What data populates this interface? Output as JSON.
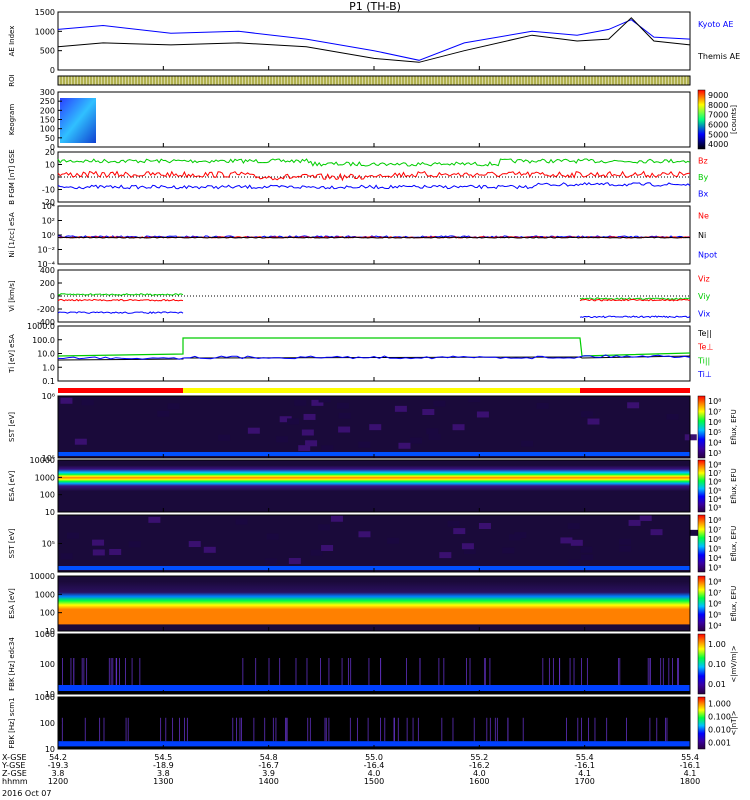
{
  "title": "P1 (TH-B)",
  "colors": {
    "blue": "#0000ff",
    "black": "#000000",
    "green": "#00cc00",
    "red": "#ff0000",
    "yellow": "#ffff00",
    "olive": "#8a8a00",
    "dark_purple": "#1a0a3a"
  },
  "chart_data": [
    {
      "type": "line",
      "id": "ae",
      "ylabel": "AE Index",
      "ylim": [
        0,
        1500
      ],
      "yticks": [
        "1500",
        "1000",
        "500",
        "0"
      ],
      "legend": [
        "Kyoto AE",
        "Themis AE"
      ],
      "series": [
        {
          "name": "Kyoto AE",
          "color": "#0000ff",
          "x": [
            54.2,
            54.3,
            54.45,
            54.6,
            54.75,
            54.9,
            55.0,
            55.1,
            55.25,
            55.35,
            55.42,
            55.47,
            55.52,
            55.6
          ],
          "values": [
            1050,
            1150,
            950,
            1000,
            800,
            500,
            250,
            700,
            1000,
            900,
            1050,
            1300,
            850,
            800
          ]
        },
        {
          "name": "Themis AE",
          "color": "#000000",
          "x": [
            54.2,
            54.3,
            54.45,
            54.6,
            54.75,
            54.9,
            55.0,
            55.1,
            55.25,
            55.35,
            55.42,
            55.47,
            55.52,
            55.6
          ],
          "values": [
            600,
            700,
            650,
            700,
            600,
            300,
            200,
            500,
            900,
            750,
            800,
            1350,
            750,
            650
          ]
        }
      ]
    },
    {
      "type": "table",
      "id": "roi",
      "ylabel": "ROI"
    },
    {
      "type": "heatmap",
      "id": "keogram",
      "ylabel": "Keogram",
      "yticks": [
        "300",
        "250",
        "200",
        "150",
        "100",
        "50",
        "0"
      ],
      "colorbar": {
        "ticks": [
          "9000",
          "8000",
          "7000",
          "6000",
          "5000",
          "4000"
        ],
        "label": "[counts]"
      }
    },
    {
      "type": "line",
      "id": "bfgm",
      "ylabel": "B FGM [nT] GSE",
      "yticks": [
        "20",
        "10",
        "0",
        "-10",
        "-20"
      ],
      "ylim": [
        -20,
        20
      ],
      "legend": [
        "Bz",
        "By",
        "Bx"
      ],
      "series": [
        {
          "name": "Bz",
          "color": "#ff0000"
        },
        {
          "name": "By",
          "color": "#00cc00"
        },
        {
          "name": "Bx",
          "color": "#0000ff"
        }
      ]
    },
    {
      "type": "line",
      "id": "ni",
      "ylabel": "Ni [1/cc] eSA",
      "yticks": [
        "10⁴",
        "10²",
        "10⁰",
        "10⁻²",
        "10⁻⁴"
      ],
      "legend": [
        "Ne",
        "Ni",
        "Npot"
      ]
    },
    {
      "type": "line",
      "id": "vi",
      "ylabel": "Vi [km/s]",
      "yticks": [
        "400",
        "200",
        "0",
        "-200",
        "-400"
      ],
      "ylim": [
        -500,
        500
      ],
      "legend": [
        "Viz",
        "Viy",
        "Vix"
      ]
    },
    {
      "type": "line",
      "id": "ti",
      "ylabel": "Ti [eV] eSA",
      "yticks": [
        "1000.0",
        "100.0",
        "10.0",
        "1.0",
        "0.1"
      ],
      "legend": [
        "Te||",
        "Te⊥",
        "Ti||",
        "Ti⊥"
      ]
    },
    {
      "type": "table",
      "id": "mode"
    },
    {
      "type": "heatmap",
      "id": "sst1",
      "ylabel": "SST [eV]",
      "yticks": [
        "10⁶",
        "10⁵"
      ],
      "colorbar": {
        "ticks": [
          "10⁸",
          "10⁷",
          "10⁶",
          "10⁵",
          "10⁴",
          "10³"
        ],
        "label": "Eflux, EFU"
      }
    },
    {
      "type": "heatmap",
      "id": "esa1",
      "ylabel": "ESA [eV]",
      "yticks": [
        "10000",
        "1000",
        "100",
        "10"
      ],
      "colorbar": {
        "ticks": [
          "10⁸",
          "10⁷",
          "10⁶",
          "10⁵",
          "10⁴",
          "10³"
        ],
        "label": "Eflux, EFU"
      }
    },
    {
      "type": "heatmap",
      "id": "sst2",
      "ylabel": "SST [eV]",
      "yticks": [
        "10⁵"
      ],
      "colorbar": {
        "ticks": [
          "10⁸",
          "10⁷",
          "10⁶",
          "10⁵",
          "10⁴",
          "10³"
        ],
        "label": "Eflux, EFU"
      }
    },
    {
      "type": "heatmap",
      "id": "esa2",
      "ylabel": "ESA [eV]",
      "yticks": [
        "10000",
        "1000",
        "100",
        "10"
      ],
      "colorbar": {
        "ticks": [
          "10⁸",
          "10⁷",
          "10⁶",
          "10⁵",
          "10⁴"
        ],
        "label": "Eflux, EFU"
      }
    },
    {
      "type": "heatmap",
      "id": "fbk1",
      "ylabel": "FBK [Hz] edc34",
      "yticks": [
        "1000",
        "100",
        "10"
      ],
      "colorbar": {
        "ticks": [
          "1.00",
          "0.10",
          "0.01"
        ],
        "label": "<|mV/m|>"
      }
    },
    {
      "type": "heatmap",
      "id": "fbk2",
      "ylabel": "FBK [Hz] scm1",
      "yticks": [
        "1000",
        "100",
        "10"
      ],
      "colorbar": {
        "ticks": [
          "1.000",
          "0.100",
          "0.010",
          "0.001"
        ],
        "label": "<|nT|>"
      }
    }
  ],
  "footer": {
    "rows": [
      {
        "label": "X-GSE",
        "values": [
          "54.2",
          "54.5",
          "54.8",
          "55.0",
          "55.2",
          "55.4",
          "55.4"
        ]
      },
      {
        "label": "Y-GSE",
        "values": [
          "-19.3",
          "-18.9",
          "-16.7",
          "-16.4",
          "-16.2",
          "-16.1",
          "-16.1"
        ]
      },
      {
        "label": "Z-GSE",
        "values": [
          "3.8",
          "3.8",
          "3.9",
          "4.0",
          "4.0",
          "4.1",
          "4.1"
        ]
      },
      {
        "label": "hhmm",
        "values": [
          "1200",
          "1300",
          "1400",
          "1500",
          "1600",
          "1700",
          "1800"
        ]
      }
    ],
    "date": "2016 Oct 07"
  }
}
